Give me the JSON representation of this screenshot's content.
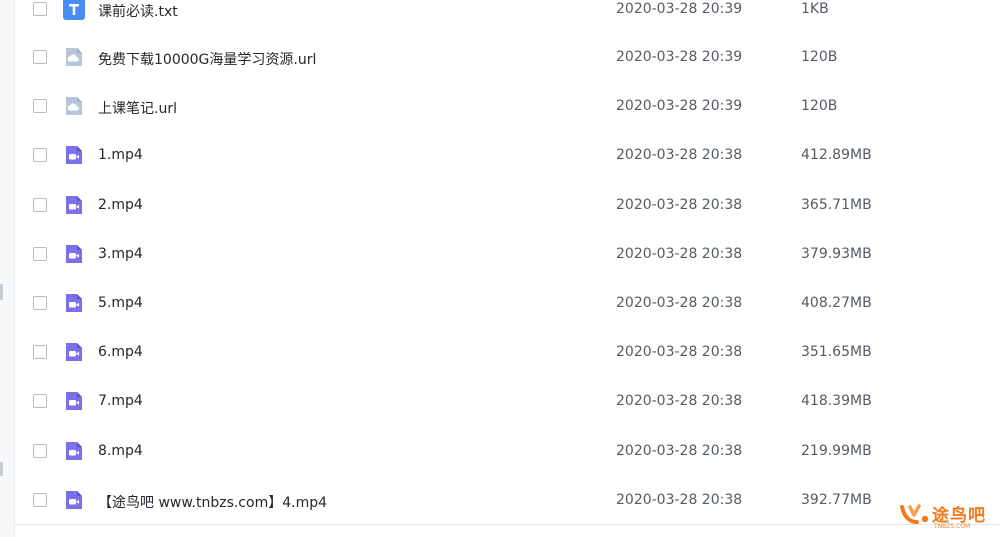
{
  "colors": {
    "txt_icon": "#4a8cf5",
    "link_icon": "#b7c6d8",
    "video_icon": "#7a70e8",
    "watermark": "#f07a1c"
  },
  "files": [
    {
      "name": "课前必读.txt",
      "date": "2020-03-28 20:39",
      "size": "1KB",
      "icon": "txt-file-icon"
    },
    {
      "name": "免费下载10000G海量学习资源.url",
      "date": "2020-03-28 20:39",
      "size": "120B",
      "icon": "link-file-icon"
    },
    {
      "name": "上课笔记.url",
      "date": "2020-03-28 20:39",
      "size": "120B",
      "icon": "link-file-icon"
    },
    {
      "name": "1.mp4",
      "date": "2020-03-28 20:38",
      "size": "412.89MB",
      "icon": "video-file-icon"
    },
    {
      "name": "2.mp4",
      "date": "2020-03-28 20:38",
      "size": "365.71MB",
      "icon": "video-file-icon"
    },
    {
      "name": "3.mp4",
      "date": "2020-03-28 20:38",
      "size": "379.93MB",
      "icon": "video-file-icon"
    },
    {
      "name": "5.mp4",
      "date": "2020-03-28 20:38",
      "size": "408.27MB",
      "icon": "video-file-icon"
    },
    {
      "name": "6.mp4",
      "date": "2020-03-28 20:38",
      "size": "351.65MB",
      "icon": "video-file-icon"
    },
    {
      "name": "7.mp4",
      "date": "2020-03-28 20:38",
      "size": "418.39MB",
      "icon": "video-file-icon"
    },
    {
      "name": "8.mp4",
      "date": "2020-03-28 20:38",
      "size": "219.99MB",
      "icon": "video-file-icon"
    },
    {
      "name": "【途鸟吧 www.tnbzs.com】4.mp4",
      "date": "2020-03-28 20:38",
      "size": "392.77MB",
      "icon": "video-file-icon"
    }
  ],
  "watermark": {
    "text": "途鸟吧",
    "subtext": "TNBZS.COM"
  }
}
